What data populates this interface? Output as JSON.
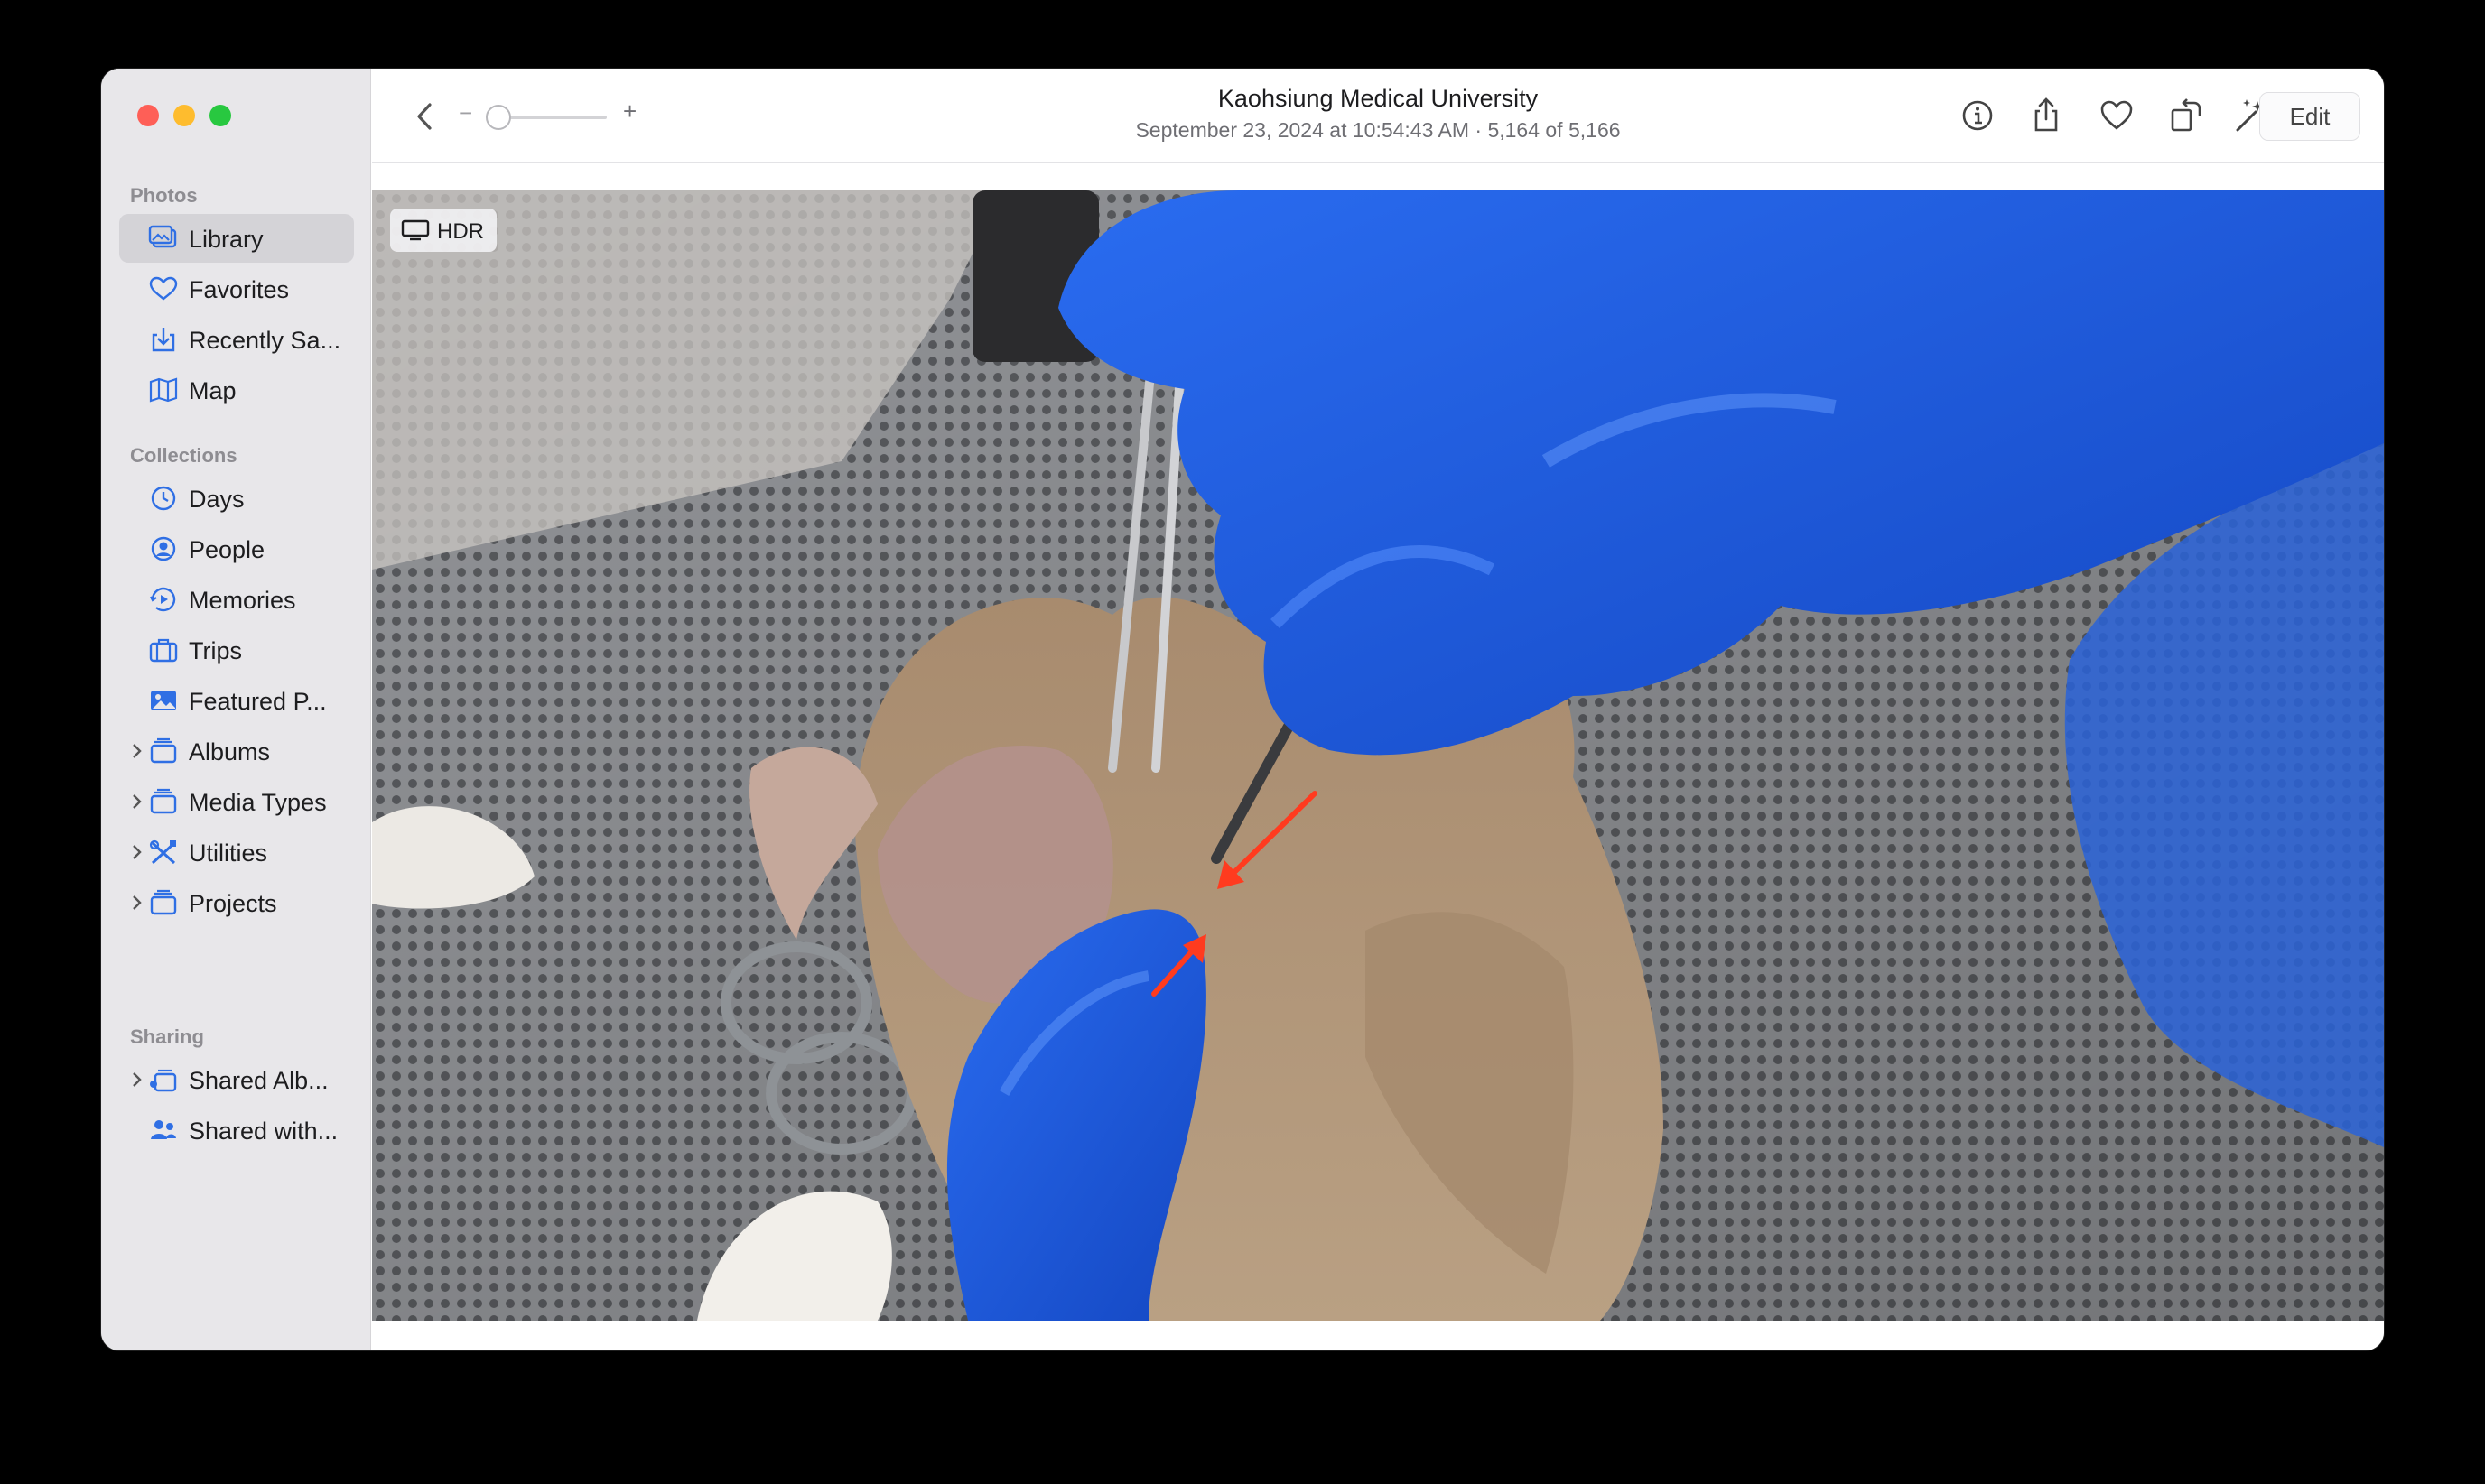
{
  "window": {
    "title": "Kaohsiung Medical University",
    "subtitle": "September 23, 2024 at 10:54:43 AM  ·  5,164 of 5,166"
  },
  "sidebar": {
    "sections": {
      "photos": "Photos",
      "collections": "Collections",
      "sharing": "Sharing"
    },
    "photos_items": [
      {
        "label": "Library",
        "icon": "library-icon",
        "selected": true
      },
      {
        "label": "Favorites",
        "icon": "heart-icon"
      },
      {
        "label": "Recently Sa...",
        "icon": "recently-saved-icon"
      },
      {
        "label": "Map",
        "icon": "map-icon"
      }
    ],
    "collections_items": [
      {
        "label": "Days",
        "icon": "clock-icon"
      },
      {
        "label": "People",
        "icon": "person-circle-icon"
      },
      {
        "label": "Memories",
        "icon": "memories-icon"
      },
      {
        "label": "Trips",
        "icon": "suitcase-icon"
      },
      {
        "label": "Featured P...",
        "icon": "photo-icon"
      },
      {
        "label": "Albums",
        "icon": "albums-icon",
        "expandable": true
      },
      {
        "label": "Media Types",
        "icon": "media-types-icon",
        "expandable": true
      },
      {
        "label": "Utilities",
        "icon": "utilities-icon",
        "expandable": true
      },
      {
        "label": "Projects",
        "icon": "projects-icon",
        "expandable": true
      }
    ],
    "sharing_items": [
      {
        "label": "Shared Alb...",
        "icon": "shared-albums-icon",
        "expandable": true
      },
      {
        "label": "Shared with...",
        "icon": "shared-with-you-icon"
      }
    ]
  },
  "toolbar": {
    "zoom_minus": "−",
    "zoom_plus": "+",
    "zoom_level": 0.0,
    "edit_label": "Edit",
    "icons": [
      "info-icon",
      "share-icon",
      "favorite-heart-icon",
      "rotate-icon",
      "auto-enhance-icon"
    ]
  },
  "photo": {
    "badge": "HDR"
  },
  "colors": {
    "accent": "#2f6fe4",
    "sidebar_bg": "#e8e7ea",
    "selected_bg": "#d4d3d7",
    "glove_blue": "#1f5ee6"
  }
}
